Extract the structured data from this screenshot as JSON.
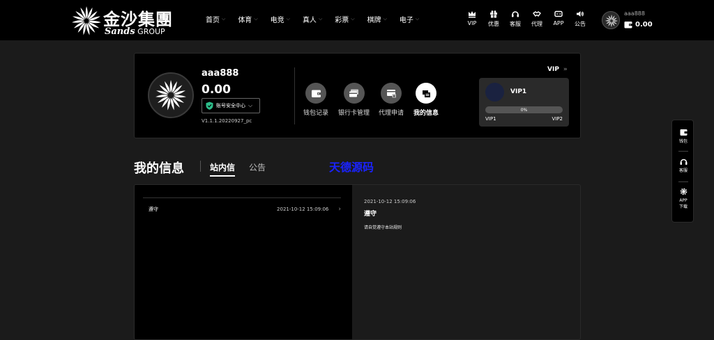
{
  "brand": {
    "name_cn": "金沙集團",
    "name_en_script": "Sands",
    "name_en_suffix": "GROUP"
  },
  "nav": {
    "items": [
      {
        "label": "首页"
      },
      {
        "label": "体育"
      },
      {
        "label": "电竞"
      },
      {
        "label": "真人"
      },
      {
        "label": "彩票"
      },
      {
        "label": "棋牌"
      },
      {
        "label": "电子"
      }
    ]
  },
  "tools": [
    {
      "label": "VIP",
      "icon": "crown-icon"
    },
    {
      "label": "优惠",
      "icon": "gift-icon"
    },
    {
      "label": "客服",
      "icon": "headset-icon"
    },
    {
      "label": "代理",
      "icon": "handshake-icon"
    },
    {
      "label": "APP",
      "icon": "controller-icon"
    },
    {
      "label": "公告",
      "icon": "speaker-icon"
    }
  ],
  "header_user": {
    "username": "aaa888",
    "balance": "0.00"
  },
  "profile": {
    "username": "aaa888",
    "balance": "0.00",
    "security_label": "账号安全中心",
    "version": "V1.1.1.20220927_pc"
  },
  "actions": [
    {
      "label": "钱包记录",
      "icon": "wallet-icon",
      "active": false
    },
    {
      "label": "银行卡管理",
      "icon": "bank-card-icon",
      "active": false
    },
    {
      "label": "代理申请",
      "icon": "agent-card-icon",
      "active": false
    },
    {
      "label": "我的信息",
      "icon": "message-icon",
      "active": true
    }
  ],
  "vip": {
    "link_label": "VIP",
    "current": "VIP1",
    "progress_text": "0%",
    "progress": 0,
    "from": "VIP1",
    "to": "VIP2"
  },
  "section": {
    "title": "我的信息",
    "tabs": [
      {
        "label": "站内信",
        "active": true
      },
      {
        "label": "公告",
        "active": false
      }
    ],
    "watermark": "天德源码"
  },
  "messages": [
    {
      "subject": "遵守",
      "time": "2021-10-12 15:09:06"
    }
  ],
  "detail": {
    "time": "2021-10-12 15:09:06",
    "title": "遵守",
    "body": "请自觉遵守本站规则"
  },
  "side": [
    {
      "label": "钱包",
      "icon": "wallet-icon"
    },
    {
      "label": "客服",
      "icon": "headset-icon"
    },
    {
      "label": "APP\n下载",
      "icon": "gear-icon"
    }
  ],
  "colors": {
    "background": "#1b1b1b",
    "header": "#000000",
    "card": "#000000",
    "watermark": "#1a23ff",
    "shield": "#2dbd8a"
  }
}
